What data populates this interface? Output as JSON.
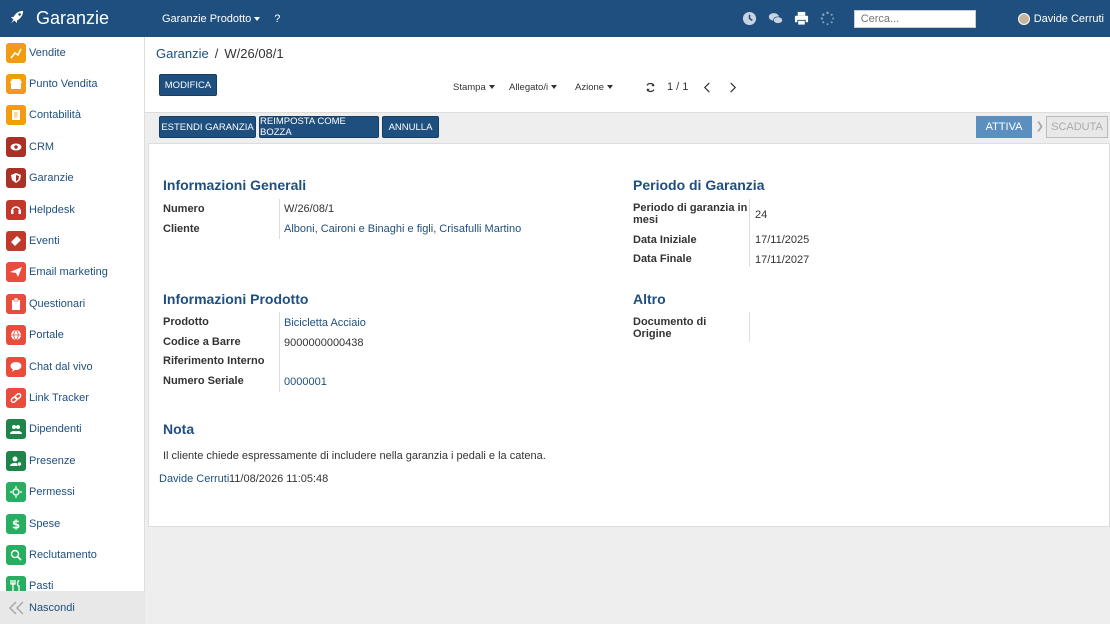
{
  "app": {
    "title": "Garanzie"
  },
  "topmenu": {
    "model_menu": "Garanzie Prodotto",
    "help": "?"
  },
  "topbar": {
    "search_placeholder": "Cerca...",
    "user_name": "Davide Cerruti"
  },
  "sidebar": {
    "items": [
      {
        "label": "Vendite",
        "icon": "chart-icon",
        "color": "#f39c12"
      },
      {
        "label": "Punto Vendita",
        "icon": "store-icon",
        "color": "#f39c12"
      },
      {
        "label": "Contabilità",
        "icon": "document-icon",
        "color": "#f39c12"
      },
      {
        "label": "CRM",
        "icon": "eye-icon",
        "color": "#a93226"
      },
      {
        "label": "Garanzie",
        "icon": "shield-icon",
        "color": "#a93226"
      },
      {
        "label": "Helpdesk",
        "icon": "headset-icon",
        "color": "#c0392b"
      },
      {
        "label": "Eventi",
        "icon": "ticket-icon",
        "color": "#c0392b"
      },
      {
        "label": "Email marketing",
        "icon": "paper-plane-icon",
        "color": "#e74c3c"
      },
      {
        "label": "Questionari",
        "icon": "clipboard-icon",
        "color": "#e74c3c"
      },
      {
        "label": "Portale",
        "icon": "globe-icon",
        "color": "#e74c3c"
      },
      {
        "label": "Chat dal vivo",
        "icon": "chat-icon",
        "color": "#e74c3c"
      },
      {
        "label": "Link Tracker",
        "icon": "link-icon",
        "color": "#e74c3c"
      },
      {
        "label": "Dipendenti",
        "icon": "users-icon",
        "color": "#1e8449"
      },
      {
        "label": "Presenze",
        "icon": "user-clock-icon",
        "color": "#1e8449"
      },
      {
        "label": "Permessi",
        "icon": "sun-icon",
        "color": "#27ae60"
      },
      {
        "label": "Spese",
        "icon": "dollar-icon",
        "color": "#27ae60"
      },
      {
        "label": "Reclutamento",
        "icon": "search-user-icon",
        "color": "#27ae60"
      },
      {
        "label": "Pasti",
        "icon": "cutlery-icon",
        "color": "#27ae60"
      }
    ],
    "hide_label": "Nascondi"
  },
  "breadcrumb": {
    "parent": "Garanzie",
    "separator": "/",
    "current": "W/26/08/1"
  },
  "controls": {
    "edit_label": "MODIFICA",
    "print_label": "Stampa",
    "attachment_label": "Allegato/i",
    "action_label": "Azione",
    "pager_value": "1 / 1"
  },
  "statusbar": {
    "buttons": [
      "ESTENDI GARANZIA",
      "REIMPOSTA COME BOZZA",
      "ANNULLA"
    ],
    "stage_active": "ATTIVA",
    "stage_next": "SCADUTA"
  },
  "form": {
    "general": {
      "title": "Informazioni Generali",
      "number_label": "Numero",
      "number_value": "W/26/08/1",
      "customer_label": "Cliente",
      "customer_value": "Alboni, Caironi e Binaghi e figli, Crisafulli Martino"
    },
    "period": {
      "title": "Periodo di Garanzia",
      "months_label_1": "Periodo di garanzia in",
      "months_label_2": "mesi",
      "months_value": "24",
      "start_label": "Data Iniziale",
      "start_value": "17/11/2025",
      "end_label": "Data Finale",
      "end_value": "17/11/2027"
    },
    "product": {
      "title": "Informazioni Prodotto",
      "product_label": "Prodotto",
      "product_value": "Bicicletta Acciaio",
      "barcode_label": "Codice a Barre",
      "barcode_value": "9000000000438",
      "internal_ref_label": "Riferimento Interno",
      "serial_label": "Numero Seriale",
      "serial_value": "0000001"
    },
    "other": {
      "title": "Altro",
      "origin_label_1": "Documento di",
      "origin_label_2": "Origine"
    },
    "note": {
      "title": "Nota",
      "text": "Il cliente chiede espressamente di includere nella garanzia i pedali e la catena.",
      "author": "Davide Cerruti",
      "date": "11/08/2026 11:05:48"
    }
  },
  "colors": {
    "primary": "#1f4f7e",
    "stage_active": "#5b8fbf"
  }
}
